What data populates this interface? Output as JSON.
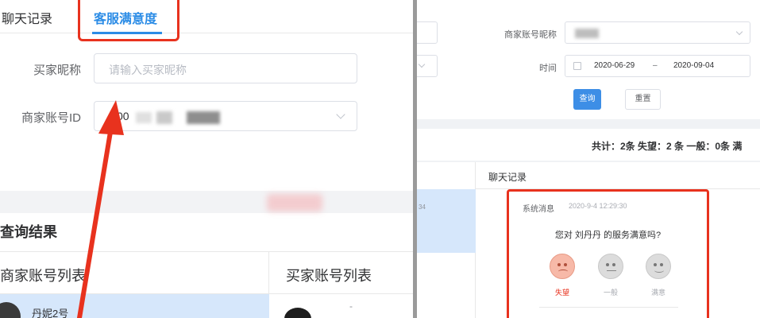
{
  "left": {
    "tabs": [
      {
        "label": "聊天记录"
      },
      {
        "label": "客服满意度"
      }
    ],
    "form": {
      "buyer_nick_label": "买家昵称",
      "buyer_nick_placeholder": "请输入买家昵称",
      "merchant_id_label": "商家账号ID",
      "merchant_id_value": "00"
    },
    "results_title": "查询结果",
    "columns": {
      "merchant_list": "商家账号列表",
      "buyer_list": "买家账号列表"
    },
    "row": {
      "merchant_name": "丹妮2号",
      "buyer_text": "-"
    }
  },
  "right": {
    "form": {
      "merchant_nick_label": "商家账号昵称",
      "time_label": "时间",
      "date_start": "2020-06-29",
      "date_sep": "–",
      "date_end": "2020-09-04",
      "query_button": "查询",
      "reset_button": "重置"
    },
    "summary": "共计：2条 失望：2 条 一般：0条 满",
    "list_stamp": "34",
    "chat_header": "聊天记录",
    "message": {
      "sender": "系统消息",
      "time": "2020-9-4 12:29:30",
      "question": "您对 刘丹丹 的服务满意吗?",
      "options": [
        "失望",
        "一般",
        "满意"
      ]
    }
  },
  "colors": {
    "accent": "#2b8ce6",
    "highlight_red": "#e8321e",
    "selected_row": "#d6e7fb"
  }
}
